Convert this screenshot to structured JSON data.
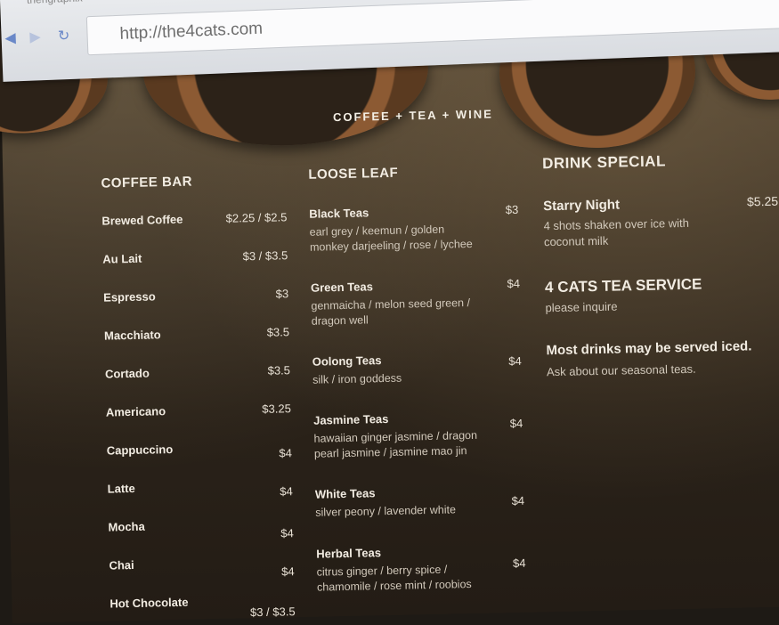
{
  "browser": {
    "tab_title": "thengraphix",
    "url": "http://the4cats.com"
  },
  "brand": "COFFEE + TEA + WINE",
  "coffee_bar": {
    "heading": "COFFEE BAR",
    "items": [
      {
        "name": "Brewed Coffee",
        "price": "$2.25 / $2.5"
      },
      {
        "name": "Au Lait",
        "price": "$3 / $3.5"
      },
      {
        "name": "Espresso",
        "price": "$3"
      },
      {
        "name": "Macchiato",
        "price": "$3.5"
      },
      {
        "name": "Cortado",
        "price": "$3.5"
      },
      {
        "name": "Americano",
        "price": "$3.25"
      },
      {
        "name": "Cappuccino",
        "price": "$4"
      },
      {
        "name": "Latte",
        "price": "$4"
      },
      {
        "name": "Mocha",
        "price": "$4"
      },
      {
        "name": "Chai",
        "price": "$4"
      },
      {
        "name": "Hot Chocolate",
        "price": "$3 / $3.5"
      }
    ]
  },
  "loose_leaf": {
    "heading": "LOOSE LEAF",
    "items": [
      {
        "name": "Black Teas",
        "price": "$3",
        "desc": "earl grey / keemun / golden monkey darjeeling / rose / lychee"
      },
      {
        "name": "Green Teas",
        "price": "$4",
        "desc": "genmaicha / melon seed green / dragon well"
      },
      {
        "name": "Oolong Teas",
        "price": "$4",
        "desc": "silk / iron goddess"
      },
      {
        "name": "Jasmine Teas",
        "price": "$4",
        "desc": "hawaiian ginger jasmine / dragon pearl jasmine / jasmine mao jin"
      },
      {
        "name": "White Teas",
        "price": "$4",
        "desc": "silver peony / lavender white"
      },
      {
        "name": "Herbal Teas",
        "price": "$4",
        "desc": "citrus ginger / berry spice / chamomile / rose mint / roobios"
      }
    ]
  },
  "specials": {
    "heading": "DRINK SPECIAL",
    "special_name": "Starry Night",
    "special_price": "$5.25",
    "special_desc": "4 shots shaken over ice with coconut milk",
    "tea_service_heading": "4 CATS TEA SERVICE",
    "tea_service_sub": "please inquire",
    "iced_note": "Most drinks may be served iced.",
    "seasonal_note": "Ask about our seasonal teas."
  }
}
